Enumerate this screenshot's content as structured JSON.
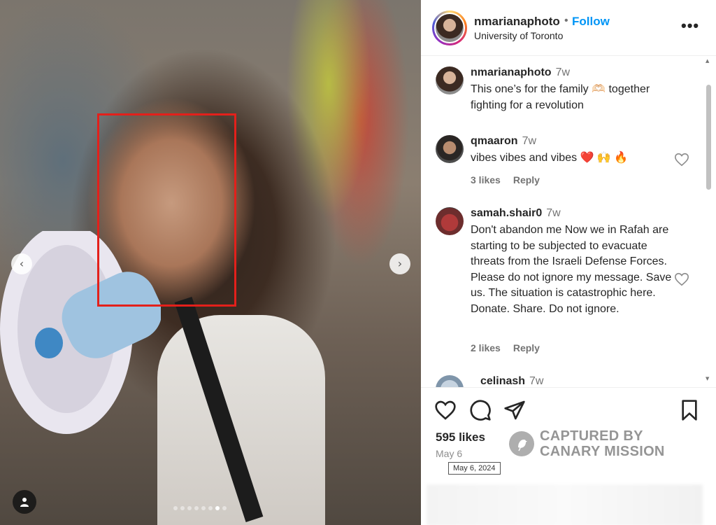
{
  "post": {
    "username": "nmarianaphoto",
    "separator": "•",
    "follow_label": "Follow",
    "location": "University of Toronto",
    "more_label": "•••"
  },
  "media": {
    "prev_label": "‹",
    "next_label": "›",
    "carousel_count": 8,
    "carousel_active_index": 6
  },
  "comments": [
    {
      "username": "nmarianaphoto",
      "time": "7w",
      "text": "This one’s for the family 🫶🏻 together fighting for a revolution",
      "likes": "",
      "reply": ""
    },
    {
      "username": "qmaaron",
      "time": "7w",
      "text": "vibes vibes and vibes ❤️ 🙌 🔥",
      "likes": "3 likes",
      "reply": "Reply"
    },
    {
      "username": "samah.shair0",
      "time": "7w",
      "text": "Don't abandon me Now we in Rafah are starting to be subjected to evacuate threats from the Israeli Defense Forces. Please do not ignore my message. Save us. The situation is catastrophic here. Donate. Share. Do not ignore.",
      "likes": "2 likes",
      "reply": "Reply"
    },
    {
      "username": "celinash",
      "time": "7w",
      "text": "",
      "likes": "",
      "reply": ""
    }
  ],
  "footer": {
    "likes": "595 likes",
    "date": "May 6",
    "date_tooltip": "May 6, 2024"
  },
  "watermark": {
    "line1": "CAPTURED BY",
    "line2": "CANARY MISSION"
  },
  "icons": {
    "like": "heart-icon",
    "comment": "comment-icon",
    "share": "share-icon",
    "save": "bookmark-icon"
  },
  "colors": {
    "follow": "#0095f6",
    "highlight_box": "#e3201b",
    "heart_red": "#ed4956"
  }
}
